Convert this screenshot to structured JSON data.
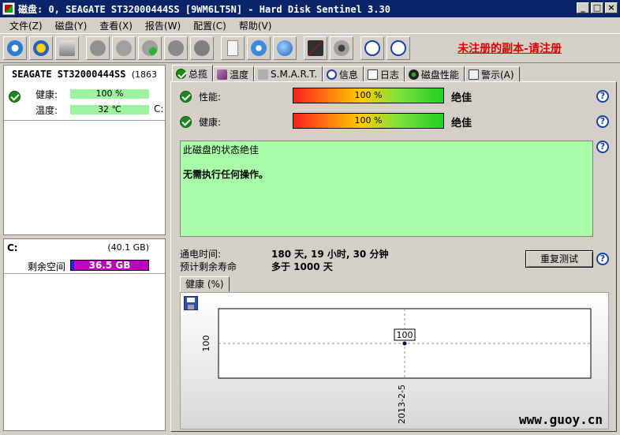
{
  "window": {
    "title": "磁盘: 0, SEAGATE ST32000444SS [9WM6LT5N] - Hard Disk Sentinel 3.30",
    "minimize": "_",
    "maximize": "□",
    "close": "×"
  },
  "menu": [
    "文件(Z)",
    "磁盘(Y)",
    "查看(X)",
    "报告(W)",
    "配置(C)",
    "帮助(V)"
  ],
  "unregistered": "未注册的副本-请注册",
  "left": {
    "disk_name": "SEAGATE ST32000444SS",
    "disk_size": "(1863",
    "health_label": "健康:",
    "health_value": "100 %",
    "temp_label": "温度:",
    "temp_value": "32 ℃",
    "drive_letter_short": "C:",
    "volume_letter": "C:",
    "volume_size": "(40.1 GB)",
    "free_label": "剩余空间",
    "free_value": "36.5 GB"
  },
  "tabs": [
    {
      "label": "总揽",
      "icon": "check-icon"
    },
    {
      "label": "温度",
      "icon": "thermometer-icon"
    },
    {
      "label": "S.M.A.R.T.",
      "icon": "disk-icon"
    },
    {
      "label": "信息",
      "icon": "info-icon"
    },
    {
      "label": "日志",
      "icon": "log-icon"
    },
    {
      "label": "磁盘性能",
      "icon": "gauge-icon"
    },
    {
      "label": "警示(A)",
      "icon": "alert-icon"
    }
  ],
  "overview": {
    "performance_label": "性能:",
    "performance_value": "100 %",
    "performance_rating": "绝佳",
    "health_label": "健康:",
    "health_value": "100 %",
    "health_rating": "绝佳",
    "status_line1": "此磁盘的状态绝佳",
    "status_line2": "无需执行任何操作。",
    "power_on_label": "通电时间:",
    "power_on_value": "180 天, 19 小时, 30 分钟",
    "remaining_label": "预计剩余寿命",
    "remaining_value": "多于 1000 天",
    "retest_button": "重复测试",
    "chart_tab": "健康 (%)"
  },
  "chart_data": {
    "type": "line",
    "x": [
      "2013-2-5"
    ],
    "series": [
      {
        "values": [
          100
        ]
      }
    ],
    "point_label": "100",
    "y_tick": "100",
    "x_tick": "2013-2-5"
  },
  "watermark": "www.guoy.cn",
  "help_glyph": "?"
}
